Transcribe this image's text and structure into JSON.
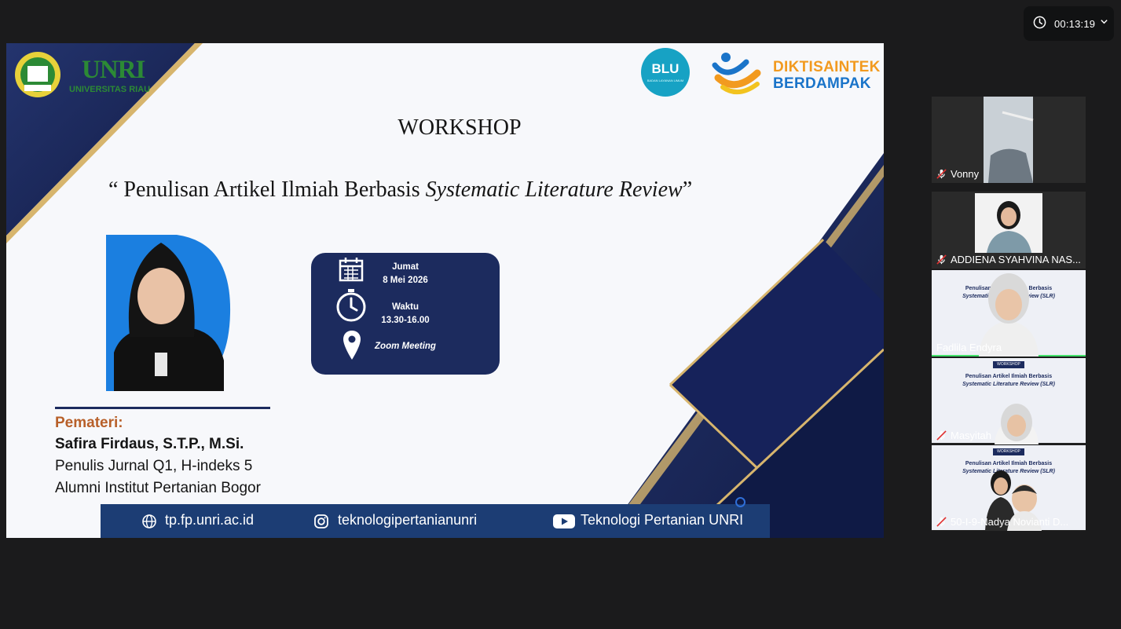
{
  "timer": {
    "time": "00:13:19",
    "icon": "clock-icon"
  },
  "slide": {
    "unri_logo_text": "UNRI",
    "unri_sub": "UNIVERSITAS RIAU",
    "blu_text": "BLU",
    "blu_sub": "BADAN LAYANAN UMUM",
    "dikti_line1": "DIKTISAINTEK",
    "dikti_line2": "BERDAMPAK",
    "title": "WORKSHOP",
    "subtitle_pre": "“ Penulisan Artikel Ilmiah Berbasis ",
    "subtitle_italic": "Systematic Literature Review",
    "subtitle_post": "”",
    "day": "Jumat",
    "date": "8 Mei 2026",
    "time_label": "Waktu",
    "time_value": "13.30-16.00",
    "place": "Zoom Meeting",
    "speaker_heading": "Pemateri:",
    "speaker_name": "Safira Firdaus, S.T.P., M.Si.",
    "speaker_line2": "Penulis Jurnal Q1, H-indeks 5",
    "speaker_line3": "Alumni Institut Pertanian Bogor",
    "footer_web": "tp.fp.unri.ac.id",
    "footer_ig": "teknologipertanianunri",
    "footer_yt": "Teknologi Pertanian UNRI",
    "colors": {
      "navy": "#1c2b5e",
      "gold": "#d7b56d",
      "accent_orange": "#b8602a"
    }
  },
  "participants": [
    {
      "name": "Vonny",
      "muted": true
    },
    {
      "name": "ADDIENA SYAHVINA NAS...",
      "muted": true
    },
    {
      "name": "Fadlila Endyra",
      "muted": false,
      "active": true
    },
    {
      "name": "Masyitah",
      "muted": true
    },
    {
      "name": "50-I-9-Nadya Novianti D...",
      "muted": true
    }
  ],
  "mini_slide": {
    "workshop": "WORKSHOP",
    "line1": "Penulisan Artikel Ilmiah Berbasis",
    "line2": "Systematic Literature Review (SLR)"
  }
}
